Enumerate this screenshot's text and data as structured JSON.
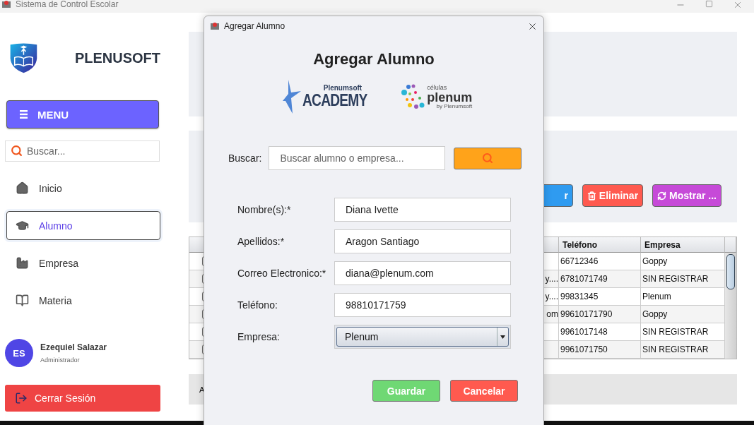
{
  "window": {
    "title": "Sistema de Control Escolar"
  },
  "sidebar": {
    "brand": "PLENUSOFT",
    "menu_button": "MENU",
    "search": {
      "placeholder": "Buscar..."
    },
    "nav_items": [
      {
        "label": "Inicio",
        "kind": "home",
        "selected": false
      },
      {
        "label": "Alumno",
        "kind": "student",
        "selected": true
      },
      {
        "label": "Empresa",
        "kind": "company",
        "selected": false
      },
      {
        "label": "Materia",
        "kind": "subject",
        "selected": false
      }
    ],
    "user": {
      "initials": "ES",
      "name": "Ezequiel Salazar",
      "role": "Administrador"
    },
    "logout_button": "Cerrar Sesión"
  },
  "toolbar": {
    "buttons": [
      {
        "label": "r",
        "kind": "plain",
        "color": "#2f9bf0"
      },
      {
        "label": "Eliminar",
        "kind": "delete",
        "color": "#ff5a4f"
      },
      {
        "label": "Mostrar ...",
        "kind": "refresh",
        "color": "#c64ad8"
      }
    ]
  },
  "table": {
    "columns": [
      {
        "label": "Teléfono"
      },
      {
        "label": "Empresa"
      }
    ],
    "rows": [
      {
        "checked": false,
        "telefono": "66712346",
        "empresa": "Goppy"
      },
      {
        "checked": false,
        "column_3": "y....",
        "telefono": "6781071749",
        "empresa": "SIN REGISTRAR"
      },
      {
        "checked": false,
        "column_3": "y....",
        "telefono": "99831345",
        "empresa": "Plenum"
      },
      {
        "checked": false,
        "column_3": "om",
        "telefono": "99610171790",
        "empresa": "Goppy"
      },
      {
        "checked": false,
        "telefono": "9961017148",
        "empresa": "SIN REGISTRAR"
      },
      {
        "checked": false,
        "telefono": "9961071750",
        "empresa": "SIN REGISTRAR"
      }
    ]
  },
  "status_bar": "A",
  "dialog": {
    "title": "Agregar Alumno",
    "heading": "Agregar Alumno",
    "logo_academy": {
      "top": "Plenumsoft",
      "main": "ACADEMY"
    },
    "logo_celulas": {
      "top": "células",
      "main": "plenum",
      "bottom": "by Plenumsoft"
    },
    "search": {
      "label": "Buscar:",
      "placeholder": "Buscar alumno o empresa..."
    },
    "fields": [
      {
        "label": "Nombre(s):*",
        "value": "Diana Ivette",
        "kind": "text"
      },
      {
        "label": "Apellidos:*",
        "value": "Aragon Santiago",
        "kind": "text"
      },
      {
        "label": "Correo Electronico:*",
        "value": "diana@plenum.com",
        "kind": "text"
      },
      {
        "label": "Teléfono:",
        "value": "98810171759",
        "kind": "text"
      },
      {
        "label": "Empresa:",
        "value": "Plenum",
        "kind": "select"
      }
    ],
    "buttons": [
      {
        "label": "Guardar",
        "color": "#6fd874"
      },
      {
        "label": "Cancelar",
        "color": "#ff5a4f"
      }
    ]
  }
}
